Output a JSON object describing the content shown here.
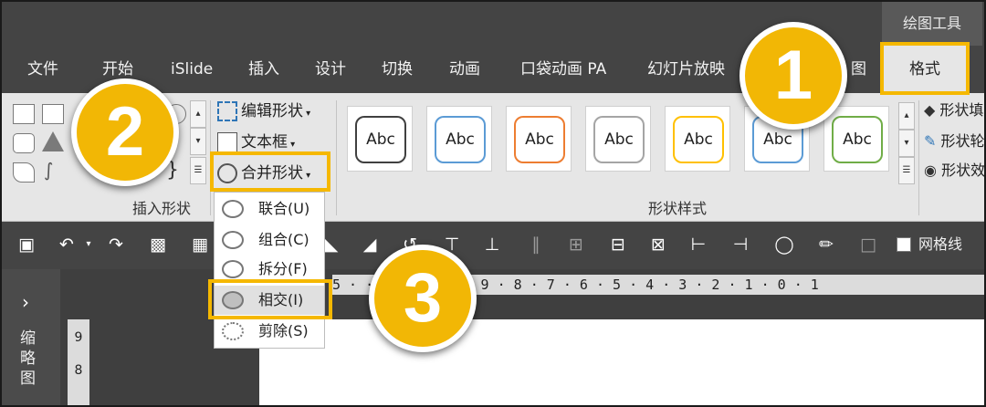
{
  "window": {
    "context_tab_group": "绘图工具"
  },
  "tabs": [
    {
      "label": "文件"
    },
    {
      "label": "开始"
    },
    {
      "label": "iSlide"
    },
    {
      "label": "插入"
    },
    {
      "label": "设计"
    },
    {
      "label": "切换"
    },
    {
      "label": "动画"
    },
    {
      "label": "口袋动画 PA"
    },
    {
      "label": "幻灯片放映"
    },
    {
      "label": "图"
    },
    {
      "label": "格式"
    }
  ],
  "ribbon": {
    "insert_shapes": {
      "group_label": "插入形状",
      "edit_shape": "编辑形状",
      "text_box": "文本框",
      "merge_shapes": "合并形状"
    },
    "shape_styles": {
      "group_label": "形状样式",
      "thumbnails": [
        {
          "text": "Abc",
          "border": "#404040"
        },
        {
          "text": "Abc",
          "border": "#5b9bd5"
        },
        {
          "text": "Abc",
          "border": "#ed7d31"
        },
        {
          "text": "Abc",
          "border": "#a5a5a5"
        },
        {
          "text": "Abc",
          "border": "#ffc000"
        },
        {
          "text": "Abc",
          "border": "#5b9bd5"
        },
        {
          "text": "Abc",
          "border": "#70ad47"
        }
      ],
      "fill": "形状填",
      "outline": "形状轮",
      "effect": "形状效"
    }
  },
  "merge_menu": {
    "items": [
      {
        "label": "联合(U)"
      },
      {
        "label": "组合(C)"
      },
      {
        "label": "拆分(F)"
      },
      {
        "label": "相交(I)"
      },
      {
        "label": "剪除(S)"
      }
    ]
  },
  "toolbar": {
    "gridlines_label": "网格线"
  },
  "sidebar": {
    "label": "缩略图"
  },
  "ruler": {
    "horizontal": "5 · · · 11 · 10 · 9 · 8 · 7 · 6 · 5 · 4 · 3 · 2 · 1 · 0 · 1",
    "vertical": [
      "9",
      "8"
    ]
  },
  "callouts": [
    "1",
    "2",
    "3"
  ],
  "colors": {
    "accent": "#f5b800",
    "callout_fill": "#f2b705",
    "dark_bg": "#444444",
    "ribbon_bg": "#e6e6e6"
  }
}
